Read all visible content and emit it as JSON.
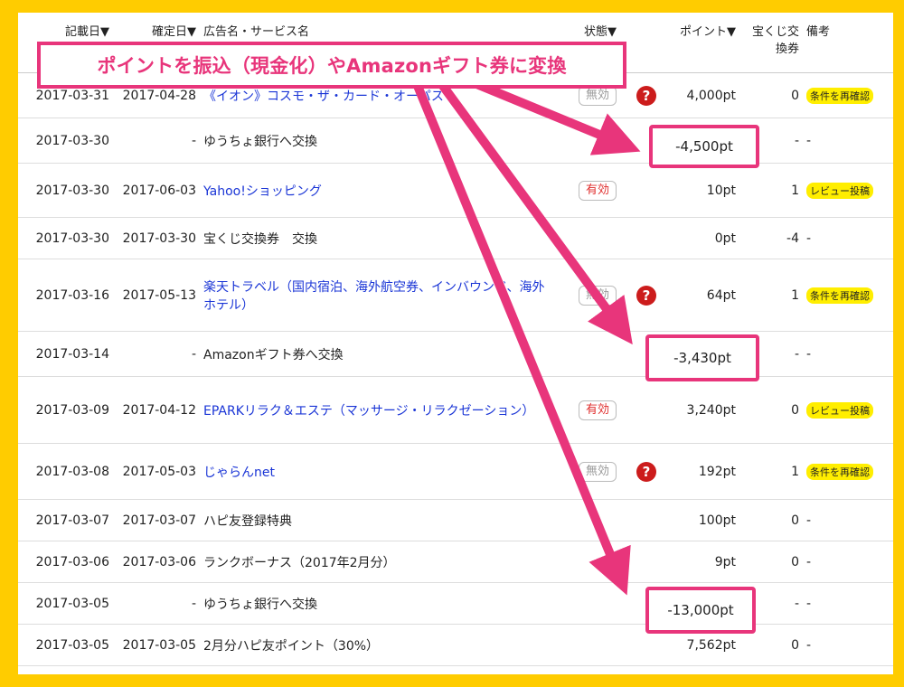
{
  "header": {
    "col_recorded": "記載日▼",
    "col_confirmed": "確定日▼",
    "col_ad": "広告名・サービス名",
    "col_status": "状態▼",
    "col_points": "ポイント▼",
    "col_lottery": "宝くじ交換券",
    "col_note": "備考"
  },
  "annotations": {
    "banner": "ポイントを振込（現金化）やAmazonギフト券に変換",
    "highlights": [
      "-4,500pt",
      "-3,430pt",
      "-13,000pt"
    ],
    "accent_color": "#e8357b"
  },
  "rows": [
    {
      "recorded": "2017-03-31",
      "confirmed": "2017-04-28",
      "name": "《イオン》コスモ・ザ・カード・オーパス",
      "link": true,
      "status": "無効",
      "status_type": "invalid",
      "help": true,
      "points": "4,000pt",
      "lottery": "0",
      "note": "条件を再確認",
      "note_badge": true
    },
    {
      "recorded": "2017-03-30",
      "confirmed": "-",
      "name": "ゆうちょ銀行へ交換",
      "link": false,
      "status": "",
      "status_type": "",
      "help": false,
      "points": "-4,500pt",
      "lottery": "-",
      "note": "-",
      "note_badge": false
    },
    {
      "recorded": "2017-03-30",
      "confirmed": "2017-06-03",
      "name": "Yahoo!ショッピング",
      "link": true,
      "status": "有効",
      "status_type": "valid",
      "help": false,
      "points": "10pt",
      "lottery": "1",
      "note": "レビュー投稿",
      "note_badge": true
    },
    {
      "recorded": "2017-03-30",
      "confirmed": "2017-03-30",
      "name": "宝くじ交換券　交換",
      "link": false,
      "status": "",
      "status_type": "",
      "help": false,
      "points": "0pt",
      "lottery": "-4",
      "note": "-",
      "note_badge": false
    },
    {
      "recorded": "2017-03-16",
      "confirmed": "2017-05-13",
      "name": "楽天トラベル（国内宿泊、海外航空券、インバウンド、海外ホテル）",
      "link": true,
      "status": "無効",
      "status_type": "invalid",
      "help": true,
      "points": "64pt",
      "lottery": "1",
      "note": "条件を再確認",
      "note_badge": true
    },
    {
      "recorded": "2017-03-14",
      "confirmed": "-",
      "name": "Amazonギフト券へ交換",
      "link": false,
      "status": "",
      "status_type": "",
      "help": false,
      "points": "-3,430pt",
      "lottery": "-",
      "note": "-",
      "note_badge": false
    },
    {
      "recorded": "2017-03-09",
      "confirmed": "2017-04-12",
      "name": "EPARKリラク＆エステ（マッサージ・リラクゼーション）",
      "link": true,
      "status": "有効",
      "status_type": "valid",
      "help": false,
      "points": "3,240pt",
      "lottery": "0",
      "note": "レビュー投稿",
      "note_badge": true
    },
    {
      "recorded": "2017-03-08",
      "confirmed": "2017-05-03",
      "name": "じゃらんnet",
      "link": true,
      "status": "無効",
      "status_type": "invalid",
      "help": true,
      "points": "192pt",
      "lottery": "1",
      "note": "条件を再確認",
      "note_badge": true
    },
    {
      "recorded": "2017-03-07",
      "confirmed": "2017-03-07",
      "name": "ハピ友登録特典",
      "link": false,
      "status": "",
      "status_type": "",
      "help": false,
      "points": "100pt",
      "lottery": "0",
      "note": "-",
      "note_badge": false
    },
    {
      "recorded": "2017-03-06",
      "confirmed": "2017-03-06",
      "name": "ランクボーナス（2017年2月分）",
      "link": false,
      "status": "",
      "status_type": "",
      "help": false,
      "points": "9pt",
      "lottery": "0",
      "note": "-",
      "note_badge": false
    },
    {
      "recorded": "2017-03-05",
      "confirmed": "-",
      "name": "ゆうちょ銀行へ交換",
      "link": false,
      "status": "",
      "status_type": "",
      "help": false,
      "points": "-13,000pt",
      "lottery": "-",
      "note": "-",
      "note_badge": false
    },
    {
      "recorded": "2017-03-05",
      "confirmed": "2017-03-05",
      "name": "2月分ハピ友ポイント（30%）",
      "link": false,
      "status": "",
      "status_type": "",
      "help": false,
      "points": "7,562pt",
      "lottery": "0",
      "note": "-",
      "note_badge": false
    }
  ]
}
